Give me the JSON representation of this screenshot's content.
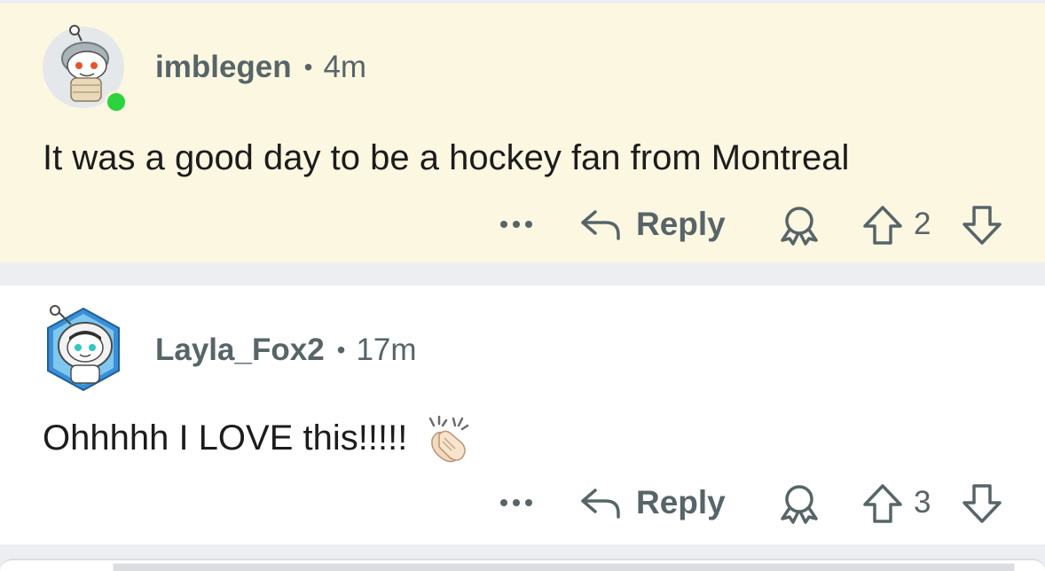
{
  "comments": [
    {
      "username": "imblegen",
      "separator": "•",
      "time": "4m",
      "body": "It was a good day to be a hockey fan from Montreal",
      "reply_label": "Reply",
      "score": "2",
      "highlighted": true,
      "online": true
    },
    {
      "username": "Layla_Fox2",
      "separator": "•",
      "time": "17m",
      "body": "Ohhhhh I LOVE this!!!!!",
      "reply_label": "Reply",
      "score": "3",
      "highlighted": false,
      "emoji": "clapping-hands-emoji"
    }
  ],
  "icons": {
    "more": "more-options-icon",
    "reply": "reply-arrow-icon",
    "award": "award-icon",
    "upvote": "upvote-arrow-icon",
    "downvote": "downvote-arrow-icon"
  },
  "colors": {
    "highlight_bg": "#fcf7e1",
    "meta_text": "#576569",
    "body_text": "#1c1c1c",
    "online_dot": "#2bd33d"
  }
}
